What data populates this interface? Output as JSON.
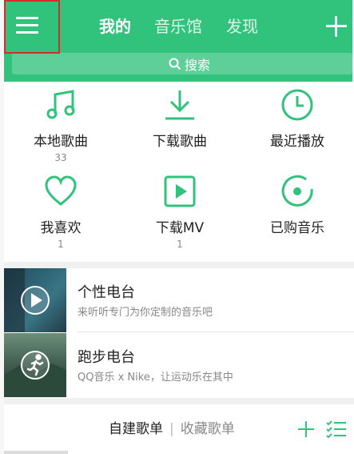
{
  "header": {
    "tabs": [
      {
        "label": "我的",
        "active": true
      },
      {
        "label": "音乐馆",
        "active": false
      },
      {
        "label": "发现",
        "active": false
      }
    ],
    "search_label": "搜索"
  },
  "shortcuts": [
    {
      "label": "本地歌曲",
      "count": "33",
      "icon": "music-note-icon"
    },
    {
      "label": "下载歌曲",
      "count": "",
      "icon": "download-icon"
    },
    {
      "label": "最近播放",
      "count": "",
      "icon": "clock-icon"
    },
    {
      "label": "我喜欢",
      "count": "1",
      "icon": "heart-icon"
    },
    {
      "label": "下载MV",
      "count": "1",
      "icon": "video-icon"
    },
    {
      "label": "已购音乐",
      "count": "",
      "icon": "purchased-disc-icon"
    }
  ],
  "radios": [
    {
      "title": "个性电台",
      "subtitle": "来听听专门为你定制的音乐吧",
      "icon": "play-icon"
    },
    {
      "title": "跑步电台",
      "subtitle": "QQ音乐 x Nike，让运动乐在其中",
      "icon": "runner-icon"
    }
  ],
  "playlists": {
    "tab_created": "自建歌单",
    "separator": "|",
    "tab_collected": "收藏歌单"
  },
  "colors": {
    "brand_green": "#31c27c",
    "highlight_red": "#d52b2b"
  }
}
